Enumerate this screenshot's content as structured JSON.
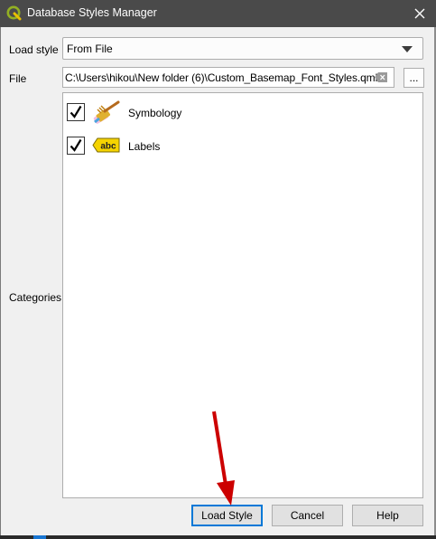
{
  "window": {
    "title": "Database Styles Manager"
  },
  "form": {
    "load_style_label": "Load style",
    "load_style_value": "From File",
    "file_label": "File",
    "file_path": "C:\\Users\\hikou\\New folder (6)\\Custom_Basemap_Font_Styles.qml",
    "browse_label": "...",
    "categories_label": "Categories"
  },
  "categories": [
    {
      "label": "Symbology",
      "checked": true,
      "icon": "symbology-paintbrush-icon"
    },
    {
      "label": "Labels",
      "checked": true,
      "icon": "labels-abc-icon",
      "icon_text": "abc"
    }
  ],
  "buttons": {
    "load": "Load Style",
    "cancel": "Cancel",
    "help": "Help"
  },
  "colors": {
    "titlebar": "#4a4a4a",
    "accent": "#0078d7",
    "annotation_arrow": "#cc0000"
  }
}
